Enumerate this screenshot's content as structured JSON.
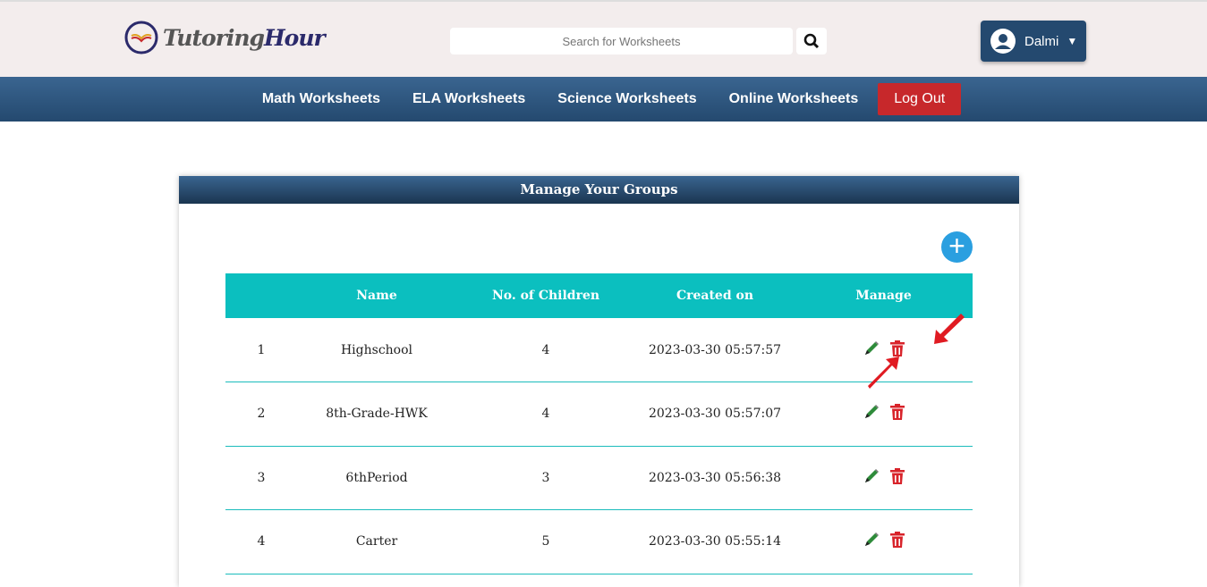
{
  "brand": {
    "name_part1": "Tutoring",
    "name_part2": "Hour"
  },
  "search": {
    "placeholder": "Search for Worksheets"
  },
  "user": {
    "name": "Dalmi"
  },
  "nav": [
    "Math Worksheets",
    "ELA Worksheets",
    "Science Worksheets",
    "Online Worksheets",
    "Log Out"
  ],
  "panel": {
    "title": "Manage Your Groups",
    "columns": [
      "",
      "Name",
      "No. of Children",
      "Created on",
      "Manage"
    ],
    "rows": [
      {
        "n": "1",
        "name": "Highschool",
        "children": "4",
        "created": "2023-03-30 05:57:57"
      },
      {
        "n": "2",
        "name": "8th-Grade-HWK",
        "children": "4",
        "created": "2023-03-30 05:57:07"
      },
      {
        "n": "3",
        "name": "6thPeriod",
        "children": "3",
        "created": "2023-03-30 05:56:38"
      },
      {
        "n": "4",
        "name": "Carter",
        "children": "5",
        "created": "2023-03-30 05:55:14"
      }
    ]
  },
  "colors": {
    "nav": "#24496f",
    "header": "#0bbfbf",
    "logout": "#c7282b",
    "edit": "#2e8b3a",
    "delete": "#d8232a",
    "add": "#2a9fe0"
  }
}
